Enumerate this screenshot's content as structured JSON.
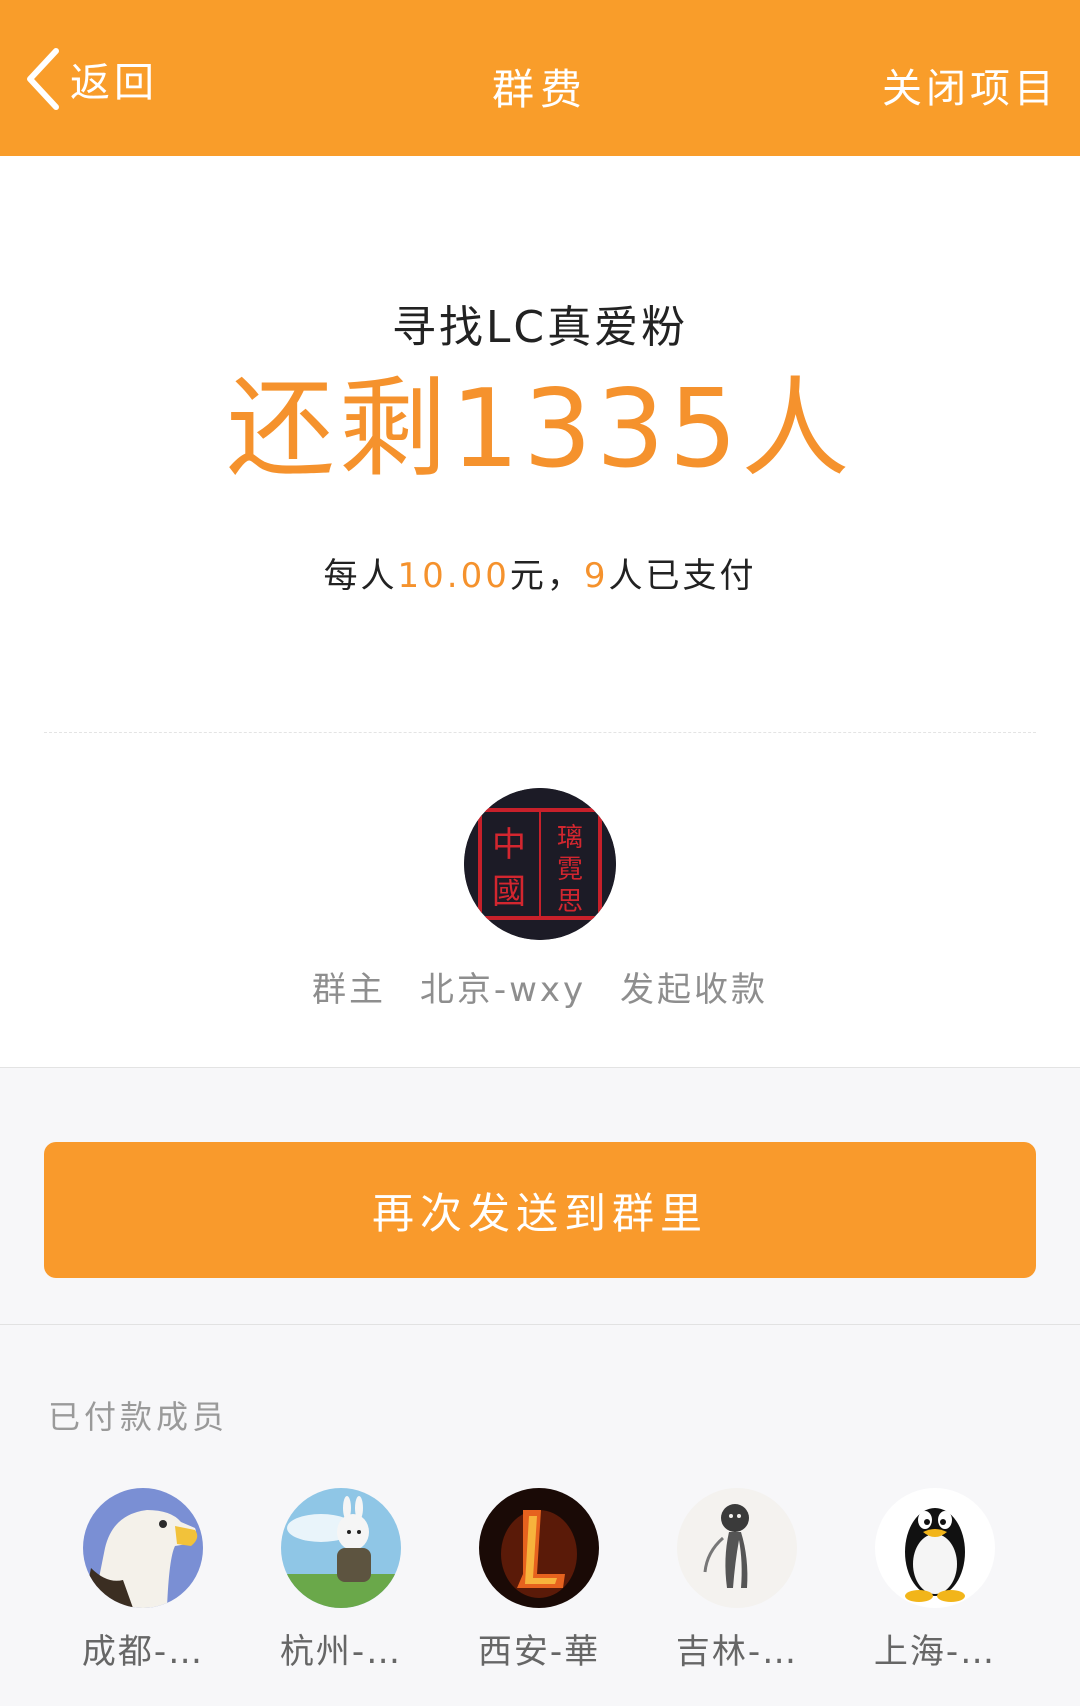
{
  "header": {
    "back_label": "返回",
    "title": "群费",
    "close_label": "关闭项目"
  },
  "summary": {
    "project_name": "寻找LC真爱粉",
    "remaining_text": "还剩1335人",
    "per_person_prefix": "每人",
    "per_person_amount": "10.00",
    "per_person_unit": "元，",
    "paid_count": "9",
    "paid_suffix": "人已支付",
    "owner_role": "群主",
    "owner_name": "北京-wxy",
    "owner_action": "发起收款",
    "owner_seal_text": "中國璃霓思"
  },
  "actions": {
    "resend_label": "再次发送到群里"
  },
  "paid_members": {
    "label": "已付款成员",
    "items": [
      {
        "name": "成都-…",
        "avatar": "eagle-avatar"
      },
      {
        "name": "杭州-…",
        "avatar": "rabbit-avatar"
      },
      {
        "name": "西安-華",
        "avatar": "fire-letter-l-avatar"
      },
      {
        "name": "吉林-…",
        "avatar": "ink-figure-avatar"
      },
      {
        "name": "上海-…",
        "avatar": "penguin-avatar"
      }
    ]
  },
  "colors": {
    "brand_orange": "#f99d2a",
    "highlight_orange": "#f5922d",
    "muted_text": "#8e8e8e"
  }
}
